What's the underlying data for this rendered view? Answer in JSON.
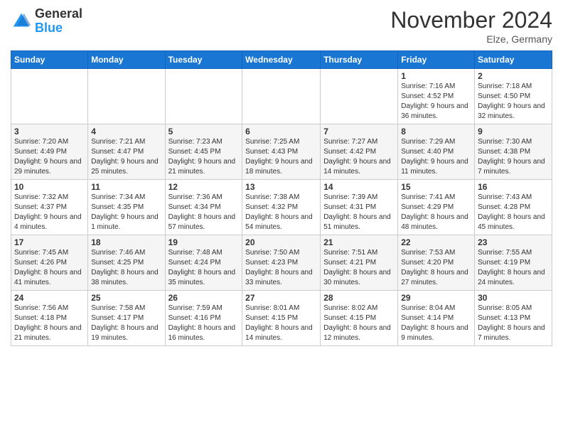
{
  "logo": {
    "general": "General",
    "blue": "Blue"
  },
  "title": "November 2024",
  "subtitle": "Elze, Germany",
  "days_header": [
    "Sunday",
    "Monday",
    "Tuesday",
    "Wednesday",
    "Thursday",
    "Friday",
    "Saturday"
  ],
  "weeks": [
    [
      {
        "day": "",
        "info": ""
      },
      {
        "day": "",
        "info": ""
      },
      {
        "day": "",
        "info": ""
      },
      {
        "day": "",
        "info": ""
      },
      {
        "day": "",
        "info": ""
      },
      {
        "day": "1",
        "info": "Sunrise: 7:16 AM\nSunset: 4:52 PM\nDaylight: 9 hours and 36 minutes."
      },
      {
        "day": "2",
        "info": "Sunrise: 7:18 AM\nSunset: 4:50 PM\nDaylight: 9 hours and 32 minutes."
      }
    ],
    [
      {
        "day": "3",
        "info": "Sunrise: 7:20 AM\nSunset: 4:49 PM\nDaylight: 9 hours and 29 minutes."
      },
      {
        "day": "4",
        "info": "Sunrise: 7:21 AM\nSunset: 4:47 PM\nDaylight: 9 hours and 25 minutes."
      },
      {
        "day": "5",
        "info": "Sunrise: 7:23 AM\nSunset: 4:45 PM\nDaylight: 9 hours and 21 minutes."
      },
      {
        "day": "6",
        "info": "Sunrise: 7:25 AM\nSunset: 4:43 PM\nDaylight: 9 hours and 18 minutes."
      },
      {
        "day": "7",
        "info": "Sunrise: 7:27 AM\nSunset: 4:42 PM\nDaylight: 9 hours and 14 minutes."
      },
      {
        "day": "8",
        "info": "Sunrise: 7:29 AM\nSunset: 4:40 PM\nDaylight: 9 hours and 11 minutes."
      },
      {
        "day": "9",
        "info": "Sunrise: 7:30 AM\nSunset: 4:38 PM\nDaylight: 9 hours and 7 minutes."
      }
    ],
    [
      {
        "day": "10",
        "info": "Sunrise: 7:32 AM\nSunset: 4:37 PM\nDaylight: 9 hours and 4 minutes."
      },
      {
        "day": "11",
        "info": "Sunrise: 7:34 AM\nSunset: 4:35 PM\nDaylight: 9 hours and 1 minute."
      },
      {
        "day": "12",
        "info": "Sunrise: 7:36 AM\nSunset: 4:34 PM\nDaylight: 8 hours and 57 minutes."
      },
      {
        "day": "13",
        "info": "Sunrise: 7:38 AM\nSunset: 4:32 PM\nDaylight: 8 hours and 54 minutes."
      },
      {
        "day": "14",
        "info": "Sunrise: 7:39 AM\nSunset: 4:31 PM\nDaylight: 8 hours and 51 minutes."
      },
      {
        "day": "15",
        "info": "Sunrise: 7:41 AM\nSunset: 4:29 PM\nDaylight: 8 hours and 48 minutes."
      },
      {
        "day": "16",
        "info": "Sunrise: 7:43 AM\nSunset: 4:28 PM\nDaylight: 8 hours and 45 minutes."
      }
    ],
    [
      {
        "day": "17",
        "info": "Sunrise: 7:45 AM\nSunset: 4:26 PM\nDaylight: 8 hours and 41 minutes."
      },
      {
        "day": "18",
        "info": "Sunrise: 7:46 AM\nSunset: 4:25 PM\nDaylight: 8 hours and 38 minutes."
      },
      {
        "day": "19",
        "info": "Sunrise: 7:48 AM\nSunset: 4:24 PM\nDaylight: 8 hours and 35 minutes."
      },
      {
        "day": "20",
        "info": "Sunrise: 7:50 AM\nSunset: 4:23 PM\nDaylight: 8 hours and 33 minutes."
      },
      {
        "day": "21",
        "info": "Sunrise: 7:51 AM\nSunset: 4:21 PM\nDaylight: 8 hours and 30 minutes."
      },
      {
        "day": "22",
        "info": "Sunrise: 7:53 AM\nSunset: 4:20 PM\nDaylight: 8 hours and 27 minutes."
      },
      {
        "day": "23",
        "info": "Sunrise: 7:55 AM\nSunset: 4:19 PM\nDaylight: 8 hours and 24 minutes."
      }
    ],
    [
      {
        "day": "24",
        "info": "Sunrise: 7:56 AM\nSunset: 4:18 PM\nDaylight: 8 hours and 21 minutes."
      },
      {
        "day": "25",
        "info": "Sunrise: 7:58 AM\nSunset: 4:17 PM\nDaylight: 8 hours and 19 minutes."
      },
      {
        "day": "26",
        "info": "Sunrise: 7:59 AM\nSunset: 4:16 PM\nDaylight: 8 hours and 16 minutes."
      },
      {
        "day": "27",
        "info": "Sunrise: 8:01 AM\nSunset: 4:15 PM\nDaylight: 8 hours and 14 minutes."
      },
      {
        "day": "28",
        "info": "Sunrise: 8:02 AM\nSunset: 4:15 PM\nDaylight: 8 hours and 12 minutes."
      },
      {
        "day": "29",
        "info": "Sunrise: 8:04 AM\nSunset: 4:14 PM\nDaylight: 8 hours and 9 minutes."
      },
      {
        "day": "30",
        "info": "Sunrise: 8:05 AM\nSunset: 4:13 PM\nDaylight: 8 hours and 7 minutes."
      }
    ]
  ]
}
